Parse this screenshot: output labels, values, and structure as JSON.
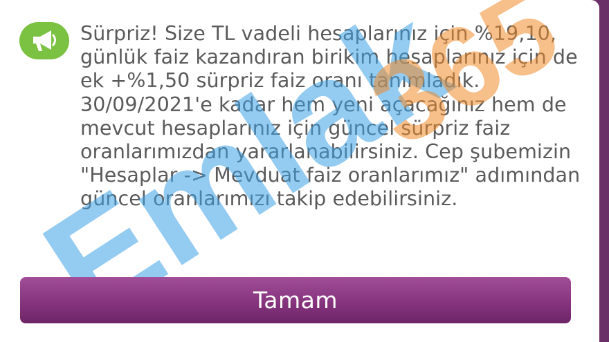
{
  "dialog": {
    "icon": "megaphone-icon",
    "message": "Sürpriz! Size TL vadeli hesaplarınız için %19,10, günlük faiz kazandıran birikim hesaplarınız için de ek +%1,50 sürpriz faiz oranı tanımladık. 30/09/2021'e kadar hem yeni açacağınız hem de mevcut hesaplarınız için güncel sürpriz faiz oranlarımızdan yararlanabilirsiniz. Cep şubemizin \"Hesaplar -> Mevduat faiz oranlarımız\" adımından güncel oranlarımızı takip edebilirsiniz.",
    "ok_label": "Tamam"
  },
  "watermark": {
    "text": "Emlak",
    "number": "365"
  },
  "colors": {
    "accent_green": "#7cc242",
    "button_purple": "#86347e",
    "background_purple": "#6a2f66",
    "text_gray": "#5a5a5a",
    "watermark_blue": "#3aa0e6",
    "watermark_orange": "#f08a2a"
  }
}
